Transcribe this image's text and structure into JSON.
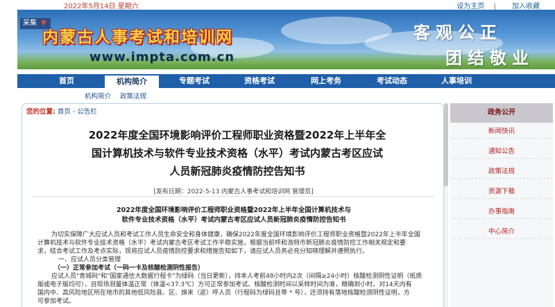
{
  "topbar": {
    "date": "2022年5月14日 星期六",
    "set_home": "设为主页",
    "separator": "|",
    "add_fav": "加入收藏"
  },
  "banner": {
    "collect_label": "采集",
    "collect_close": "▼",
    "site_title": "内蒙古人事考试和培训网",
    "url": "www.impta.com.cn",
    "slogan_line1": "客观公正",
    "slogan_line2": "团结敬业"
  },
  "nav": {
    "items": [
      {
        "label": "首页"
      },
      {
        "label": "机构简介"
      },
      {
        "label": "专题考试"
      },
      {
        "label": "资格考试"
      },
      {
        "label": "网上考务"
      },
      {
        "label": "考试动态"
      },
      {
        "label": "人事培训"
      }
    ],
    "subnav": [
      "机构简介",
      "政策法规"
    ]
  },
  "breadcrumb": {
    "prefix": "您的位置:",
    "home": "首页",
    "dash": " - ",
    "current": "公告栏"
  },
  "article": {
    "title_line1": "2022年度全国环境影响评价工程师职业资格暨2022年上半年全",
    "title_line2": "国计算机技术与软件专业技术资格（水平）考试内蒙古考区应试",
    "title_line3": "人员新冠肺炎疫情防控告知书",
    "meta": "[发布日期：2022-5-13 内蒙古人事考试和培训网 管理员]",
    "subtitle_line1": "2022年度全国环境影响评价工程师职业资格暨2022年上半年全国计算机技术与",
    "subtitle_line2": "软件专业技术资格（水平）考试内蒙古考区应试人员新冠肺炎疫情防控告知书",
    "para1_line1": "为切实保障广大应试人员和考试工作人员生命安全和身体健康，确保2022年度全国环境影响评价工程师职业资格暨2022年上半年全国",
    "para1_line2": "计算机技术与软件专业技术资格（水平）考试内蒙古考区考试工作平稳实施，根据当前呼和浩特市新冠肺炎疫情防控工作相关规定和要",
    "para1_line3": "求，结合考试工作及考点实际，现将应试人员疫情防控要求和措施告知如下，请应试人员务必充分知晓理解并遵照执行。",
    "section1": "一、应试人员分类管理",
    "section1_1": "（一）正常参加考试（一码一卡及核酸检测阴性报告）",
    "para2_line1": "应试人员\"青城码\"和\"国家通信大数据行程卡\"为绿码（当日更新），持本人考前48小时内2次（间隔≥24小时）核酸检测阴性证明（纸质",
    "para2_line2": "版或电子版均可），且现场测量体温正常（体温<37.3℃）方可正常参加考试。核酸检测时间以采样时间为准，精确到小时。对14天内有",
    "para2_line3": "国内中、高风险地区所在地市的其他低风险县、区、旗来（返）呼人员（行程码为绿码且带 * 号），还须持有落地核酸检测阴性证明，方",
    "para2_line4": "可参加考试。"
  },
  "sidebar": {
    "head": "政务公开",
    "items": [
      {
        "label": "新闻快讯"
      },
      {
        "label": "通知公告"
      },
      {
        "label": "政策法规"
      },
      {
        "label": "资源下载"
      },
      {
        "label": "办事指南"
      },
      {
        "label": "中心简介"
      }
    ]
  },
  "colors": {
    "nav_blue": "#1f5ea8",
    "accent_red": "#b11e1e",
    "title_gold": "#f3d24a"
  }
}
